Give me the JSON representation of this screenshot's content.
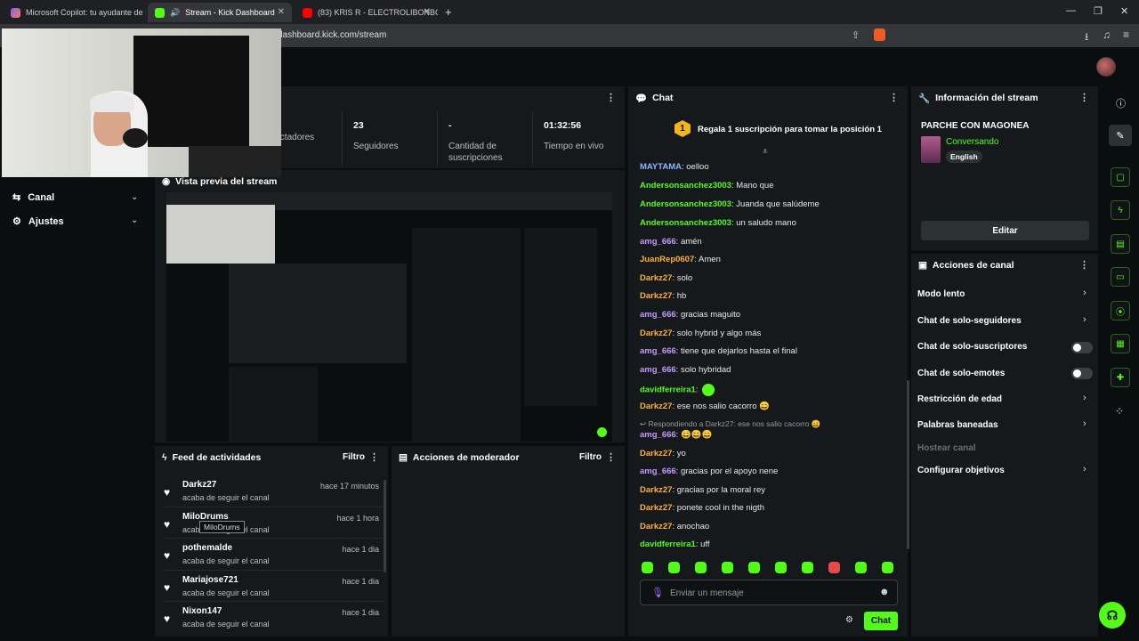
{
  "browser": {
    "tabs": [
      {
        "title": "Microsoft Copilot: tu ayudante de IA",
        "color": "#7b61ff"
      },
      {
        "title": "Stream - Kick Dashboard",
        "color": "#53fc18"
      },
      {
        "title": "(83) KRIS R - ELECTROLIBONBON",
        "color": "#ff0000"
      }
    ],
    "new_tab": "+",
    "url": "dashboard.kick.com/stream"
  },
  "nav": {
    "items": [
      {
        "label": "Canal"
      },
      {
        "label": "Ajustes"
      }
    ]
  },
  "stats": [
    {
      "value": "",
      "label": "Espectadores"
    },
    {
      "value": "23",
      "label": "Seguidores"
    },
    {
      "value": "-",
      "label": "Cantidad de suscripciones"
    },
    {
      "value": "01:32:56",
      "label": "Tiempo en vivo"
    }
  ],
  "preview": {
    "title": "Vista previa del stream"
  },
  "feed": {
    "title": "Feed de actividades",
    "filter": "Filtro",
    "items": [
      {
        "name": "Darkz27",
        "action": "acaba de seguir el canal",
        "time": "hace 17 minutos"
      },
      {
        "name": "MiloDrums",
        "action": "acaba de seguir el canal",
        "time": "hace 1 hora"
      },
      {
        "name": "pothemalde",
        "action": "acaba de seguir el canal",
        "time": "hace 1 dia"
      },
      {
        "name": "Mariajose721",
        "action": "acaba de seguir el canal",
        "time": "hace 1 dia"
      },
      {
        "name": "Nixon147",
        "action": "acaba de seguir el canal",
        "time": "hace 1 dia"
      }
    ],
    "tooltip": "MiloDrums"
  },
  "moderator": {
    "title": "Acciones de moderador",
    "filter": "Filtro"
  },
  "chat": {
    "title": "Chat",
    "pinned": "Regala 1 suscripción para tomar la posición 1",
    "pinned_rank": "1",
    "messages": [
      {
        "user": "MAYTAMA",
        "text": "oelloo",
        "color": "#8fb7ff"
      },
      {
        "user": "Andersonsanchez3003",
        "text": "Mano que",
        "color": "#53fc18"
      },
      {
        "user": "Andersonsanchez3003",
        "text": "Juanda que salúdeme",
        "color": "#53fc18"
      },
      {
        "user": "Andersonsanchez3003",
        "text": "un saludo mano",
        "color": "#53fc18"
      },
      {
        "user": "amg_666",
        "text": "amén",
        "color": "#c49bff"
      },
      {
        "user": "JuanRep0607",
        "text": "Amen",
        "color": "#ffb03a"
      },
      {
        "user": "Darkz27",
        "text": "solo",
        "color": "#ffb03a"
      },
      {
        "user": "Darkz27",
        "text": "hb",
        "color": "#ffb03a"
      },
      {
        "user": "amg_666",
        "text": "gracias maguito",
        "color": "#c49bff"
      },
      {
        "user": "Darkz27",
        "text": "solo hybrid y algo más",
        "color": "#ffb03a"
      },
      {
        "user": "amg_666",
        "text": "tiene que dejarlos hasta el final",
        "color": "#c49bff"
      },
      {
        "user": "amg_666",
        "text": "solo hybridad",
        "color": "#c49bff"
      },
      {
        "user": "davidferreira1",
        "text": "",
        "color": "#53fc18"
      },
      {
        "user": "Darkz27",
        "text": "ese nos salio cacorro 😄",
        "color": "#ffb03a"
      },
      {
        "user": "amg_666",
        "text": "😄😄😄",
        "color": "#c49bff"
      },
      {
        "user": "Darkz27",
        "text": "yo",
        "color": "#ffb03a"
      },
      {
        "user": "amg_666",
        "text": "gracias por el apoyo nene",
        "color": "#c49bff"
      },
      {
        "user": "Darkz27",
        "text": "gracias por la moral rey",
        "color": "#ffb03a"
      },
      {
        "user": "Darkz27",
        "text": "ponete cool in the nigth",
        "color": "#ffb03a"
      },
      {
        "user": "Darkz27",
        "text": "anochao",
        "color": "#ffb03a"
      },
      {
        "user": "davidferreira1",
        "text": "uff",
        "color": "#53fc18"
      }
    ],
    "reply_note": "Respondiendo a Darkz27: ese nos salio cacorro 😄",
    "input_placeholder": "Enviar un mensaje",
    "send_label": "Chat"
  },
  "stream_info": {
    "title": "Información del stream",
    "stream_title": "PARCHE CON MAGONEA",
    "category": "Conversando",
    "language": "English",
    "edit_label": "Editar"
  },
  "channel_actions": {
    "title": "Acciones de canal",
    "items": [
      {
        "label": "Modo lento",
        "control": "chevron"
      },
      {
        "label": "Chat de solo-seguidores",
        "control": "chevron"
      },
      {
        "label": "Chat de solo-suscriptores",
        "control": "toggle"
      },
      {
        "label": "Chat de solo-emotes",
        "control": "toggle"
      },
      {
        "label": "Restricción de edad",
        "control": "chevron"
      },
      {
        "label": "Palabras baneadas",
        "control": "chevron"
      },
      {
        "label": "Hostear canal",
        "control": "none"
      },
      {
        "label": "Configurar objetivos",
        "control": "chevron"
      }
    ]
  },
  "colors": {
    "accent": "#53fc18",
    "panel": "#16191b",
    "bg": "#0b0e0f"
  }
}
